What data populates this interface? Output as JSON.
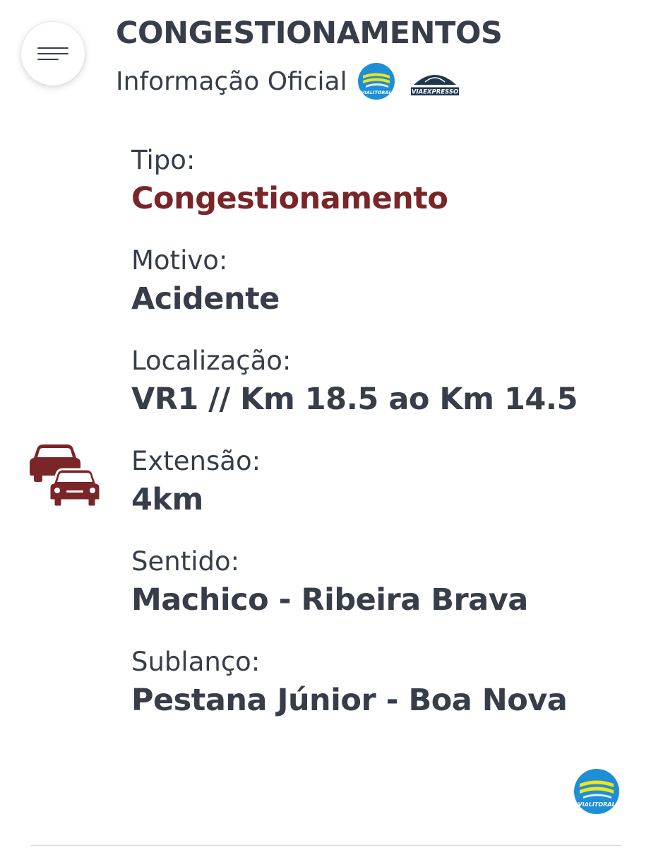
{
  "header": {
    "menu_icon": "hamburger-menu-icon",
    "title": "CONGESTIONAMENTOS",
    "subtitle": "Informação Oficial",
    "logos": [
      {
        "name": "vialitoral-logo",
        "text": "VIALITORAL"
      },
      {
        "name": "viaexpresso-logo",
        "text": "VIAEXPRESSO"
      }
    ]
  },
  "info": {
    "tipo": {
      "label": "Tipo:",
      "value": "Congestionamento"
    },
    "motivo": {
      "label": "Motivo:",
      "value": "Acidente"
    },
    "localizacao": {
      "label": "Localização:",
      "value": "VR1 // Km 18.5 ao Km 14.5"
    },
    "extensao": {
      "label": "Extensão:",
      "value": "4km"
    },
    "sentido": {
      "label": "Sentido:",
      "value": "Machico - Ribeira Brava"
    },
    "sublanco": {
      "label": "Sublanço:",
      "value": "Pestana Júnior - Boa Nova"
    }
  },
  "footer": {
    "logo_text": "VIALITORAL"
  },
  "icons": {
    "traffic": "traffic-jam-cars-icon"
  },
  "colors": {
    "text": "#373d49",
    "accent": "#7a2527",
    "vialitoral_blue": "#1e8fd6",
    "vialitoral_yellow": "#f3e41a",
    "viaexpresso_navy": "#1f3650"
  }
}
